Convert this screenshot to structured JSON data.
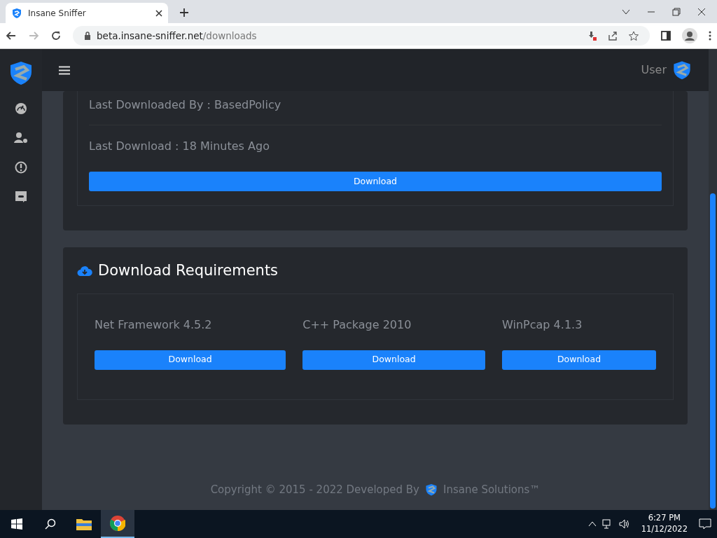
{
  "browser": {
    "tab_title": "Insane Sniffer",
    "url_host": "beta.insane-sniffer.net",
    "url_path": "/downloads"
  },
  "header": {
    "user_label": "User"
  },
  "latest": {
    "downloaded_by": "Last Downloaded By : BasedPolicy",
    "last_download": "Last Download : 18 Minutes Ago",
    "button": "Download"
  },
  "requirements": {
    "title": "Download Requirements",
    "items": [
      {
        "name": "Net Framework 4.5.2",
        "button": "Download"
      },
      {
        "name": "C++ Package 2010",
        "button": "Download"
      },
      {
        "name": "WinPcap 4.1.3",
        "button": "Download"
      }
    ]
  },
  "footer": {
    "text": "Copyright © 2015 - 2022 Developed By",
    "brand": "Insane Solutions™"
  },
  "taskbar": {
    "time": "6:27 PM",
    "date": "11/12/2022"
  }
}
